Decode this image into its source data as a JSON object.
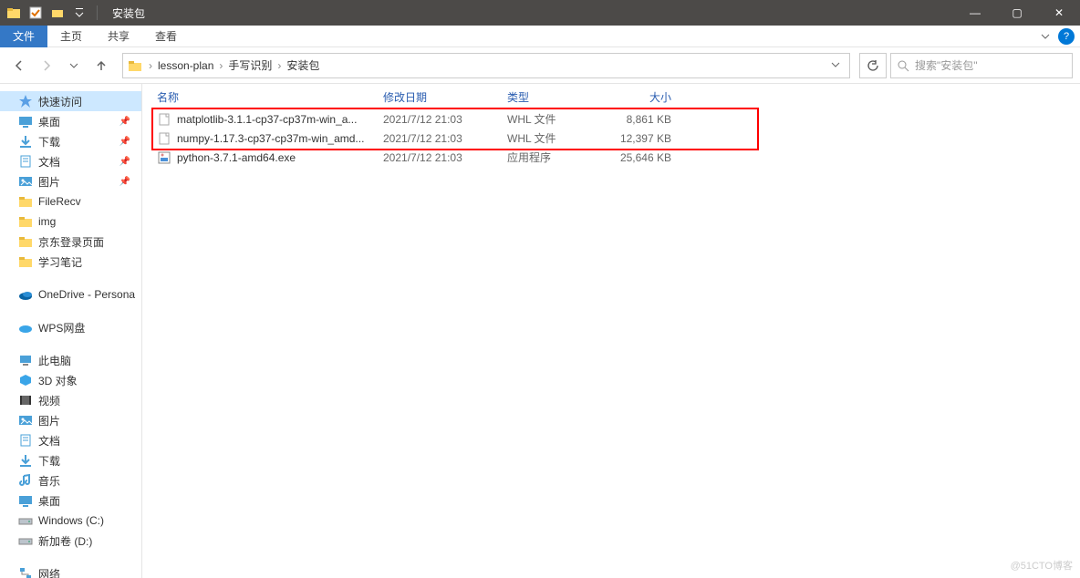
{
  "window": {
    "title": "安装包",
    "controls": {
      "min": "—",
      "max": "▢",
      "close": "✕"
    }
  },
  "menu": {
    "file": "文件",
    "home": "主页",
    "share": "共享",
    "view": "查看",
    "help": "?"
  },
  "nav": {
    "breadcrumbs": [
      "lesson-plan",
      "手写识别",
      "安装包"
    ],
    "search_placeholder": "搜索\"安装包\""
  },
  "columns": {
    "name": "名称",
    "date": "修改日期",
    "type": "类型",
    "size": "大小"
  },
  "files": [
    {
      "icon": "doc",
      "name": "matplotlib-3.1.1-cp37-cp37m-win_a...",
      "date": "2021/7/12 21:03",
      "type": "WHL 文件",
      "size": "8,861 KB"
    },
    {
      "icon": "doc",
      "name": "numpy-1.17.3-cp37-cp37m-win_amd...",
      "date": "2021/7/12 21:03",
      "type": "WHL 文件",
      "size": "12,397 KB"
    },
    {
      "icon": "exe",
      "name": "python-3.7.1-amd64.exe",
      "date": "2021/7/12 21:03",
      "type": "应用程序",
      "size": "25,646 KB"
    }
  ],
  "sidebar": {
    "groups": [
      {
        "items": [
          {
            "icon": "quick",
            "label": "快速访问",
            "active": true
          },
          {
            "icon": "desktop",
            "label": "桌面",
            "pinned": true
          },
          {
            "icon": "download",
            "label": "下载",
            "pinned": true
          },
          {
            "icon": "docs",
            "label": "文档",
            "pinned": true
          },
          {
            "icon": "pics",
            "label": "图片",
            "pinned": true
          },
          {
            "icon": "folder",
            "label": "FileRecv"
          },
          {
            "icon": "folder",
            "label": "img"
          },
          {
            "icon": "folder",
            "label": "京东登录页面"
          },
          {
            "icon": "folder",
            "label": "学习笔记"
          }
        ]
      },
      {
        "items": [
          {
            "icon": "onedrive",
            "label": "OneDrive - Persona"
          }
        ]
      },
      {
        "items": [
          {
            "icon": "wps",
            "label": "WPS网盘"
          }
        ]
      },
      {
        "items": [
          {
            "icon": "pc",
            "label": "此电脑"
          },
          {
            "icon": "3d",
            "label": "3D 对象"
          },
          {
            "icon": "video",
            "label": "视频"
          },
          {
            "icon": "pics",
            "label": "图片"
          },
          {
            "icon": "docs",
            "label": "文档"
          },
          {
            "icon": "download",
            "label": "下载"
          },
          {
            "icon": "music",
            "label": "音乐"
          },
          {
            "icon": "desktop",
            "label": "桌面"
          },
          {
            "icon": "drive",
            "label": "Windows (C:)"
          },
          {
            "icon": "drive",
            "label": "新加卷 (D:)"
          }
        ]
      },
      {
        "items": [
          {
            "icon": "network",
            "label": "网络"
          }
        ]
      }
    ]
  },
  "watermark": "@51CTO博客"
}
